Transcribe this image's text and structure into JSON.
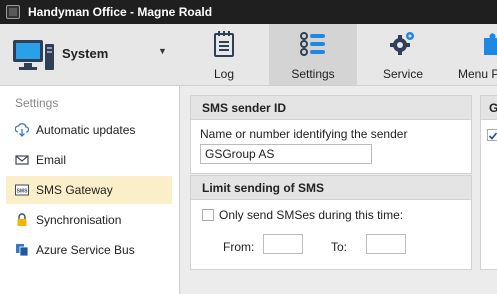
{
  "window": {
    "title": "Handyman Office - Magne Roald"
  },
  "module_selector": {
    "label": "System",
    "icon": "computer-icon",
    "dropdown_icon": "chevron-down-icon"
  },
  "sidebar": {
    "heading": "Settings",
    "items": [
      {
        "label": "Automatic updates",
        "icon": "cloud-download-icon",
        "active": false
      },
      {
        "label": "Email",
        "icon": "envelope-icon",
        "active": false
      },
      {
        "label": "SMS Gateway",
        "icon": "sms-icon",
        "active": true
      },
      {
        "label": "Synchronisation",
        "icon": "lock-icon",
        "active": false
      },
      {
        "label": "Azure Service Bus",
        "icon": "copy-icon",
        "active": false
      }
    ]
  },
  "toolbar": {
    "tabs": [
      {
        "label": "Log",
        "icon": "log-icon",
        "active": false
      },
      {
        "label": "Settings",
        "icon": "settings-list-icon",
        "active": true
      },
      {
        "label": "Service",
        "icon": "gears-icon",
        "active": false
      },
      {
        "label": "Menu P",
        "icon": "puzzle-icon",
        "active": false
      }
    ]
  },
  "sms_sender": {
    "title": "SMS sender ID",
    "field_label": "Name or number identifying the sender",
    "value": "GSGroup AS"
  },
  "limit_sms": {
    "title": "Limit sending of SMS",
    "checkbox_label": "Only send SMSes during this time:",
    "checked": false,
    "from_label": "From:",
    "from_value": "",
    "to_label": "To:",
    "to_value": ""
  },
  "right_panel": {
    "title": "G",
    "checked": true
  },
  "colors": {
    "titlebar": "#1f1f1f",
    "active_nav": "#fbefc9",
    "accent_blue": "#1e88e5",
    "icon_dark": "#2f3f55"
  }
}
